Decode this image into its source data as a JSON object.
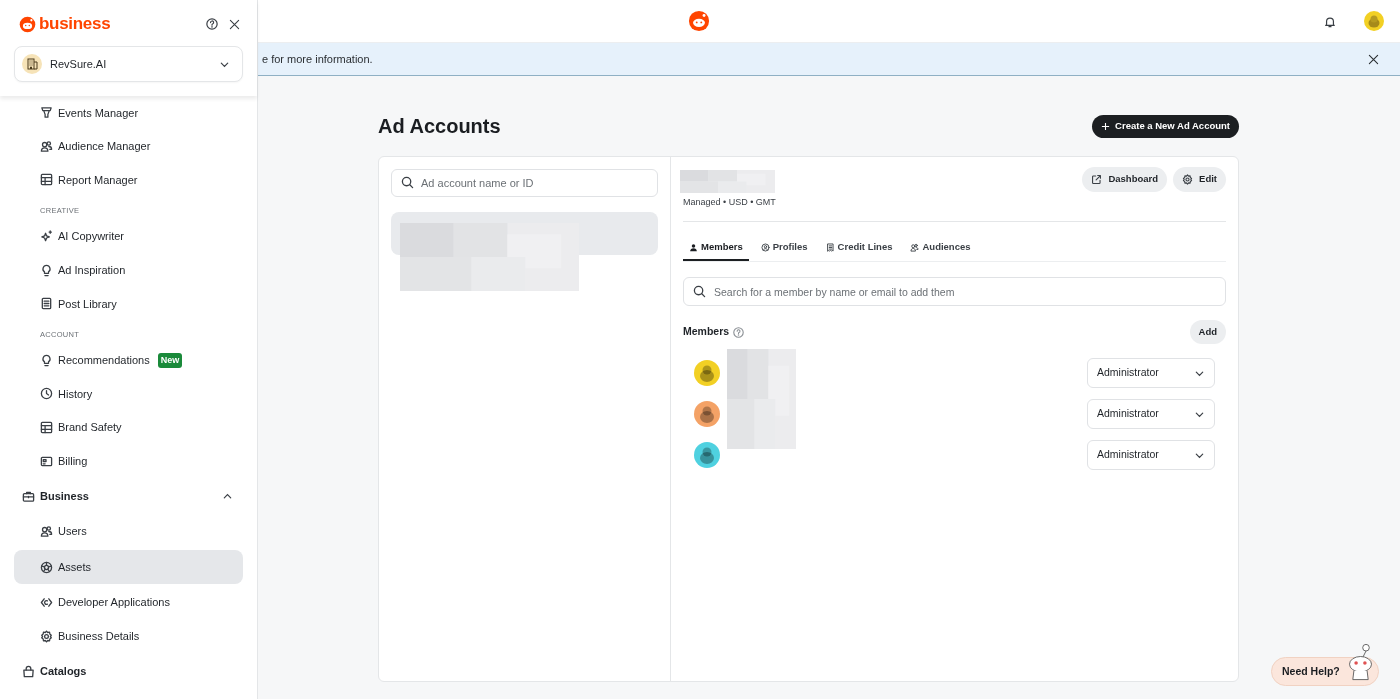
{
  "sidebar": {
    "brand": "business",
    "account": "RevSure.AI",
    "items": [
      {
        "kind": "item",
        "label": "Events Manager",
        "selected": false
      },
      {
        "kind": "item",
        "label": "Audience Manager",
        "selected": false
      },
      {
        "kind": "item",
        "label": "Report Manager",
        "selected": false
      },
      {
        "kind": "section",
        "label": "CREATIVE"
      },
      {
        "kind": "item",
        "label": "AI Copywriter",
        "selected": false
      },
      {
        "kind": "item",
        "label": "Ad Inspiration",
        "selected": false
      },
      {
        "kind": "item",
        "label": "Post Library",
        "selected": false
      },
      {
        "kind": "section",
        "label": "ACCOUNT"
      },
      {
        "kind": "item",
        "label": "Recommendations",
        "badge": "New",
        "selected": false
      },
      {
        "kind": "item",
        "label": "History",
        "selected": false
      },
      {
        "kind": "item",
        "label": "Brand Safety",
        "selected": false
      },
      {
        "kind": "item",
        "label": "Billing",
        "selected": false
      },
      {
        "kind": "group",
        "label": "Business",
        "expanded": true,
        "children": [
          {
            "label": "Users",
            "selected": false
          },
          {
            "label": "Assets",
            "selected": true
          },
          {
            "label": "Developer Applications",
            "selected": false
          },
          {
            "label": "Business Details",
            "selected": false
          }
        ]
      },
      {
        "kind": "group",
        "label": "Catalogs"
      }
    ]
  },
  "banner": {
    "text": "e for more information."
  },
  "page": {
    "title": "Ad Accounts",
    "create_button": "Create a New Ad Account",
    "account_search": {
      "placeholder": "Ad account name or ID"
    },
    "accounts": [
      {
        "selected": true
      }
    ],
    "detail": {
      "meta": "Managed • USD • GMT",
      "buttons": [
        "Dashboard",
        "Edit"
      ],
      "tabs": [
        {
          "label": "Members",
          "selected": true
        },
        {
          "label": "Profiles",
          "selected": false
        },
        {
          "label": "Credit Lines",
          "selected": false
        },
        {
          "label": "Audiences",
          "selected": false
        }
      ],
      "member_search": {
        "placeholder": "Search for a member by name or email to add them"
      },
      "members_title": "Members",
      "add_button": "Add",
      "members": [
        {
          "color": "#f2d024",
          "role": "Administrator"
        },
        {
          "color": "#f4a266",
          "role": "Administrator"
        },
        {
          "color": "#4fd1e0",
          "role": "Administrator"
        }
      ]
    }
  },
  "help_button": "Need Help?"
}
